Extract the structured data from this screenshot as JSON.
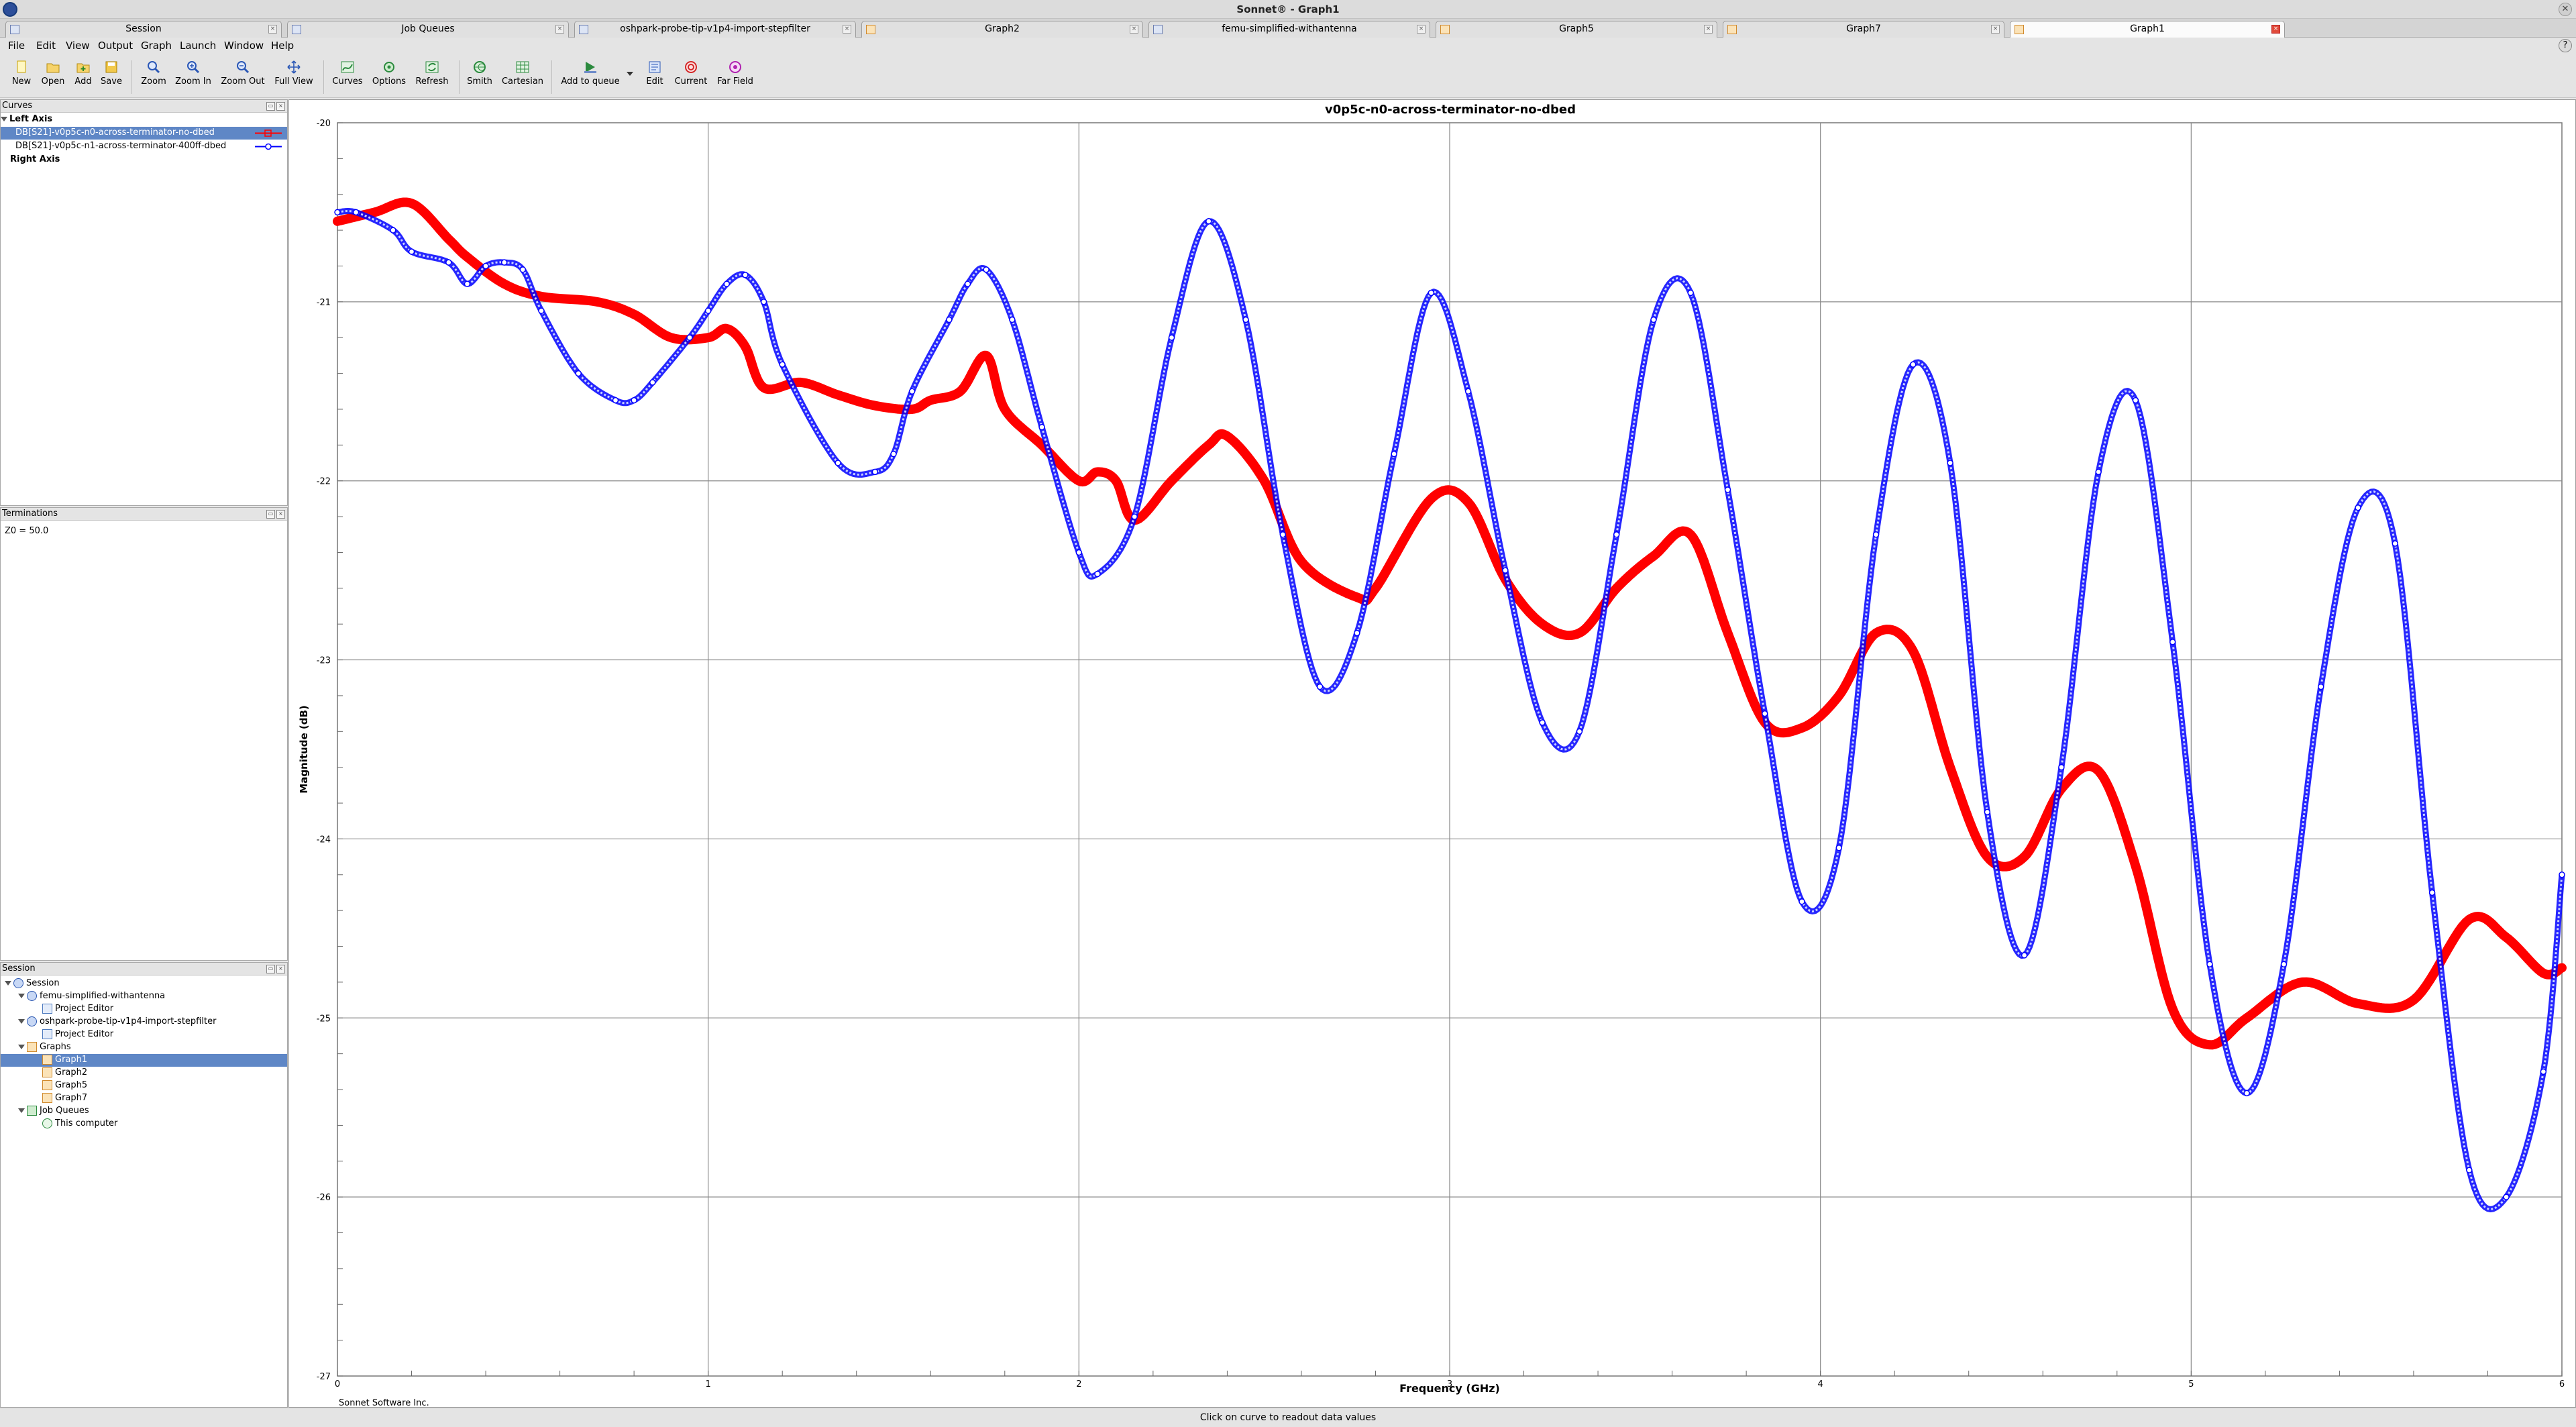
{
  "window": {
    "title": "Sonnet® - Graph1"
  },
  "tabs": [
    {
      "label": "Session",
      "icon": "session-icon",
      "active": false
    },
    {
      "label": "Job Queues",
      "icon": "job-queue-icon",
      "active": false
    },
    {
      "label": "oshpark-probe-tip-v1p4-import-stepfilter",
      "icon": "project-icon",
      "active": false
    },
    {
      "label": "Graph2",
      "icon": "graph-icon",
      "active": false
    },
    {
      "label": "femu-simplified-withantenna",
      "icon": "project-icon",
      "active": false
    },
    {
      "label": "Graph5",
      "icon": "graph-icon",
      "active": false
    },
    {
      "label": "Graph7",
      "icon": "graph-icon",
      "active": false
    },
    {
      "label": "Graph1",
      "icon": "graph-icon",
      "active": true
    }
  ],
  "menu": [
    "File",
    "Edit",
    "View",
    "Output",
    "Graph",
    "Launch",
    "Window",
    "Help"
  ],
  "toolbar": [
    {
      "label": "New",
      "icon": "new-icon"
    },
    {
      "label": "Open",
      "icon": "open-icon"
    },
    {
      "label": "Add",
      "icon": "add-icon"
    },
    {
      "label": "Save",
      "icon": "save-icon"
    },
    {
      "label": "Zoom",
      "icon": "zoom-icon"
    },
    {
      "label": "Zoom In",
      "icon": "zoom-in-icon"
    },
    {
      "label": "Zoom Out",
      "icon": "zoom-out-icon"
    },
    {
      "label": "Full View",
      "icon": "full-view-icon"
    },
    {
      "label": "Curves",
      "icon": "curves-icon"
    },
    {
      "label": "Options",
      "icon": "options-icon"
    },
    {
      "label": "Refresh",
      "icon": "refresh-icon"
    },
    {
      "label": "Smith",
      "icon": "smith-icon"
    },
    {
      "label": "Cartesian",
      "icon": "cartesian-icon"
    },
    {
      "label": "Add to queue",
      "icon": "add-to-queue-icon"
    },
    {
      "label": "Edit",
      "icon": "edit-icon"
    },
    {
      "label": "Current",
      "icon": "current-icon"
    },
    {
      "label": "Far Field",
      "icon": "far-field-icon"
    }
  ],
  "curves_panel": {
    "title": "Curves",
    "left_axis": "Left Axis",
    "right_axis": "Right Axis",
    "items": [
      {
        "label": "DB[S21]-v0p5c-n0-across-terminator-no-dbed",
        "color": "#ff0000",
        "selected": true
      },
      {
        "label": "DB[S21]-v0p5c-n1-across-terminator-400ff-dbed",
        "color": "#0000ff",
        "selected": false
      }
    ]
  },
  "terminations_panel": {
    "title": "Terminations",
    "text": "Z0 = 50.0"
  },
  "session_panel": {
    "title": "Session",
    "tree": [
      {
        "label": "Session",
        "level": 0,
        "icon": "session-icon",
        "expanded": true,
        "selected": false
      },
      {
        "label": "femu-simplified-withantenna",
        "level": 1,
        "icon": "project-icon",
        "expanded": true,
        "selected": false
      },
      {
        "label": "Project Editor",
        "level": 2,
        "icon": "editor-icon",
        "selected": false
      },
      {
        "label": "oshpark-probe-tip-v1p4-import-stepfilter",
        "level": 1,
        "icon": "project-icon",
        "expanded": true,
        "selected": false
      },
      {
        "label": "Project Editor",
        "level": 2,
        "icon": "editor-icon",
        "selected": false
      },
      {
        "label": "Graphs",
        "level": 1,
        "icon": "graph-icon",
        "expanded": true,
        "selected": false
      },
      {
        "label": "Graph1",
        "level": 2,
        "icon": "graph-icon",
        "selected": true
      },
      {
        "label": "Graph2",
        "level": 2,
        "icon": "graph-icon",
        "selected": false
      },
      {
        "label": "Graph5",
        "level": 2,
        "icon": "graph-icon",
        "selected": false
      },
      {
        "label": "Graph7",
        "level": 2,
        "icon": "graph-icon",
        "selected": false
      },
      {
        "label": "Job Queues",
        "level": 1,
        "icon": "job-queue-icon",
        "expanded": true,
        "selected": false
      },
      {
        "label": "This computer",
        "level": 2,
        "icon": "check-icon",
        "selected": false
      }
    ]
  },
  "graph": {
    "footer": "Sonnet Software Inc."
  },
  "status": "Click on curve to readout data values",
  "chart_data": {
    "type": "line",
    "title": "v0p5c-n0-across-terminator-no-dbed",
    "xlabel": "Frequency (GHz)",
    "ylabel": "Magnitude (dB)",
    "xlim": [
      0,
      6
    ],
    "ylim": [
      -27,
      -20
    ],
    "xticks": [
      0,
      1,
      2,
      3,
      4,
      5,
      6
    ],
    "yticks": [
      -20,
      -21,
      -22,
      -23,
      -24,
      -25,
      -26,
      -27
    ],
    "grid": true,
    "series": [
      {
        "name": "DB[S21]-v0p5c-n0-across-terminator-no-dbed",
        "color": "#ff0000",
        "x": [
          0,
          0.1,
          0.2,
          0.3,
          0.35,
          0.45,
          0.55,
          0.7,
          0.8,
          0.9,
          1.0,
          1.05,
          1.1,
          1.15,
          1.25,
          1.35,
          1.45,
          1.55,
          1.6,
          1.68,
          1.75,
          1.8,
          1.9,
          2.0,
          2.05,
          2.1,
          2.15,
          2.25,
          2.35,
          2.4,
          2.5,
          2.6,
          2.75,
          2.8,
          2.95,
          3.05,
          3.15,
          3.25,
          3.35,
          3.45,
          3.55,
          3.65,
          3.75,
          3.85,
          3.95,
          4.05,
          4.15,
          4.25,
          4.35,
          4.45,
          4.55,
          4.65,
          4.75,
          4.85,
          4.95,
          5.05,
          5.15,
          5.3,
          5.45,
          5.6,
          5.75,
          5.85,
          5.95,
          6.0
        ],
        "y": [
          -20.55,
          -20.5,
          -20.45,
          -20.65,
          -20.75,
          -20.9,
          -20.97,
          -21.0,
          -21.07,
          -21.2,
          -21.2,
          -21.15,
          -21.25,
          -21.48,
          -21.45,
          -21.52,
          -21.58,
          -21.6,
          -21.55,
          -21.5,
          -21.3,
          -21.6,
          -21.8,
          -22.0,
          -21.95,
          -22.0,
          -22.22,
          -22.0,
          -21.8,
          -21.75,
          -22.0,
          -22.45,
          -22.65,
          -22.6,
          -22.1,
          -22.12,
          -22.55,
          -22.8,
          -22.85,
          -22.6,
          -22.42,
          -22.3,
          -22.85,
          -23.35,
          -23.38,
          -23.2,
          -22.85,
          -22.95,
          -23.6,
          -24.1,
          -24.1,
          -23.72,
          -23.62,
          -24.15,
          -24.95,
          -25.15,
          -25.0,
          -24.8,
          -24.92,
          -24.9,
          -24.45,
          -24.55,
          -24.75,
          -24.72
        ]
      },
      {
        "name": "DB[S21]-v0p5c-n1-across-terminator-400ff-dbed",
        "color": "#0000ff",
        "x": [
          0,
          0.05,
          0.15,
          0.2,
          0.3,
          0.35,
          0.4,
          0.45,
          0.5,
          0.55,
          0.65,
          0.75,
          0.8,
          0.85,
          0.95,
          1.0,
          1.05,
          1.1,
          1.15,
          1.2,
          1.35,
          1.45,
          1.5,
          1.55,
          1.65,
          1.7,
          1.75,
          1.82,
          1.9,
          2.0,
          2.05,
          2.15,
          2.25,
          2.35,
          2.45,
          2.55,
          2.65,
          2.75,
          2.85,
          2.95,
          3.05,
          3.15,
          3.25,
          3.35,
          3.45,
          3.55,
          3.65,
          3.75,
          3.85,
          3.95,
          4.05,
          4.15,
          4.25,
          4.35,
          4.45,
          4.55,
          4.65,
          4.75,
          4.85,
          4.95,
          5.05,
          5.15,
          5.25,
          5.35,
          5.45,
          5.55,
          5.65,
          5.75,
          5.85,
          5.95,
          6.0
        ],
        "y": [
          -20.5,
          -20.5,
          -20.6,
          -20.72,
          -20.78,
          -20.9,
          -20.8,
          -20.78,
          -20.82,
          -21.05,
          -21.4,
          -21.55,
          -21.55,
          -21.45,
          -21.2,
          -21.05,
          -20.9,
          -20.85,
          -21.0,
          -21.35,
          -21.9,
          -21.95,
          -21.85,
          -21.5,
          -21.1,
          -20.9,
          -20.82,
          -21.1,
          -21.7,
          -22.4,
          -22.52,
          -22.2,
          -21.2,
          -20.55,
          -21.1,
          -22.3,
          -23.15,
          -22.85,
          -21.85,
          -20.95,
          -21.5,
          -22.5,
          -23.35,
          -23.4,
          -22.3,
          -21.1,
          -20.95,
          -22.05,
          -23.3,
          -24.35,
          -24.05,
          -22.3,
          -21.35,
          -21.9,
          -23.85,
          -24.65,
          -23.6,
          -21.95,
          -21.55,
          -22.9,
          -24.7,
          -25.42,
          -24.7,
          -23.15,
          -22.15,
          -22.35,
          -24.3,
          -25.85,
          -26.0,
          -25.3,
          -24.2
        ]
      }
    ]
  }
}
